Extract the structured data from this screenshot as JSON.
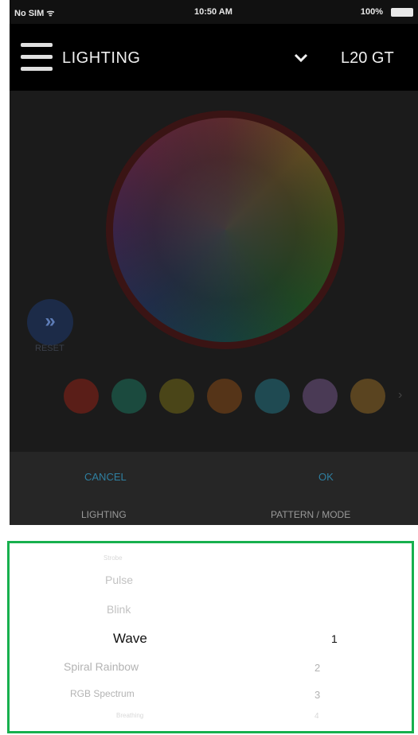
{
  "status_bar": {
    "carrier": "No SIM ᯤ",
    "time": "10:50 AM",
    "battery": "100%"
  },
  "header": {
    "title": "LIGHTING",
    "device": "L20 GT"
  },
  "reset": {
    "glyph": "»",
    "label": "RESET"
  },
  "swatches": [
    "#5a1e18",
    "#1b4a3e",
    "#4a4518",
    "#553418",
    "#1f4a52",
    "#4a3a55",
    "#5a4420"
  ],
  "actions": {
    "cancel": "CANCEL",
    "ok": "OK"
  },
  "tabs": {
    "lighting": "LIGHTING",
    "pattern": "PATTERN / MODE"
  },
  "picker": {
    "modes": [
      "Strobe",
      "Pulse",
      "Blink",
      "Wave",
      "Spiral Rainbow",
      "RGB Spectrum",
      "Breathing"
    ],
    "selected_mode": "Wave",
    "values": [
      "1",
      "2",
      "3",
      "4"
    ]
  },
  "colors": {
    "accent": "#2f7fa0",
    "highlight_border": "#17b04e"
  }
}
